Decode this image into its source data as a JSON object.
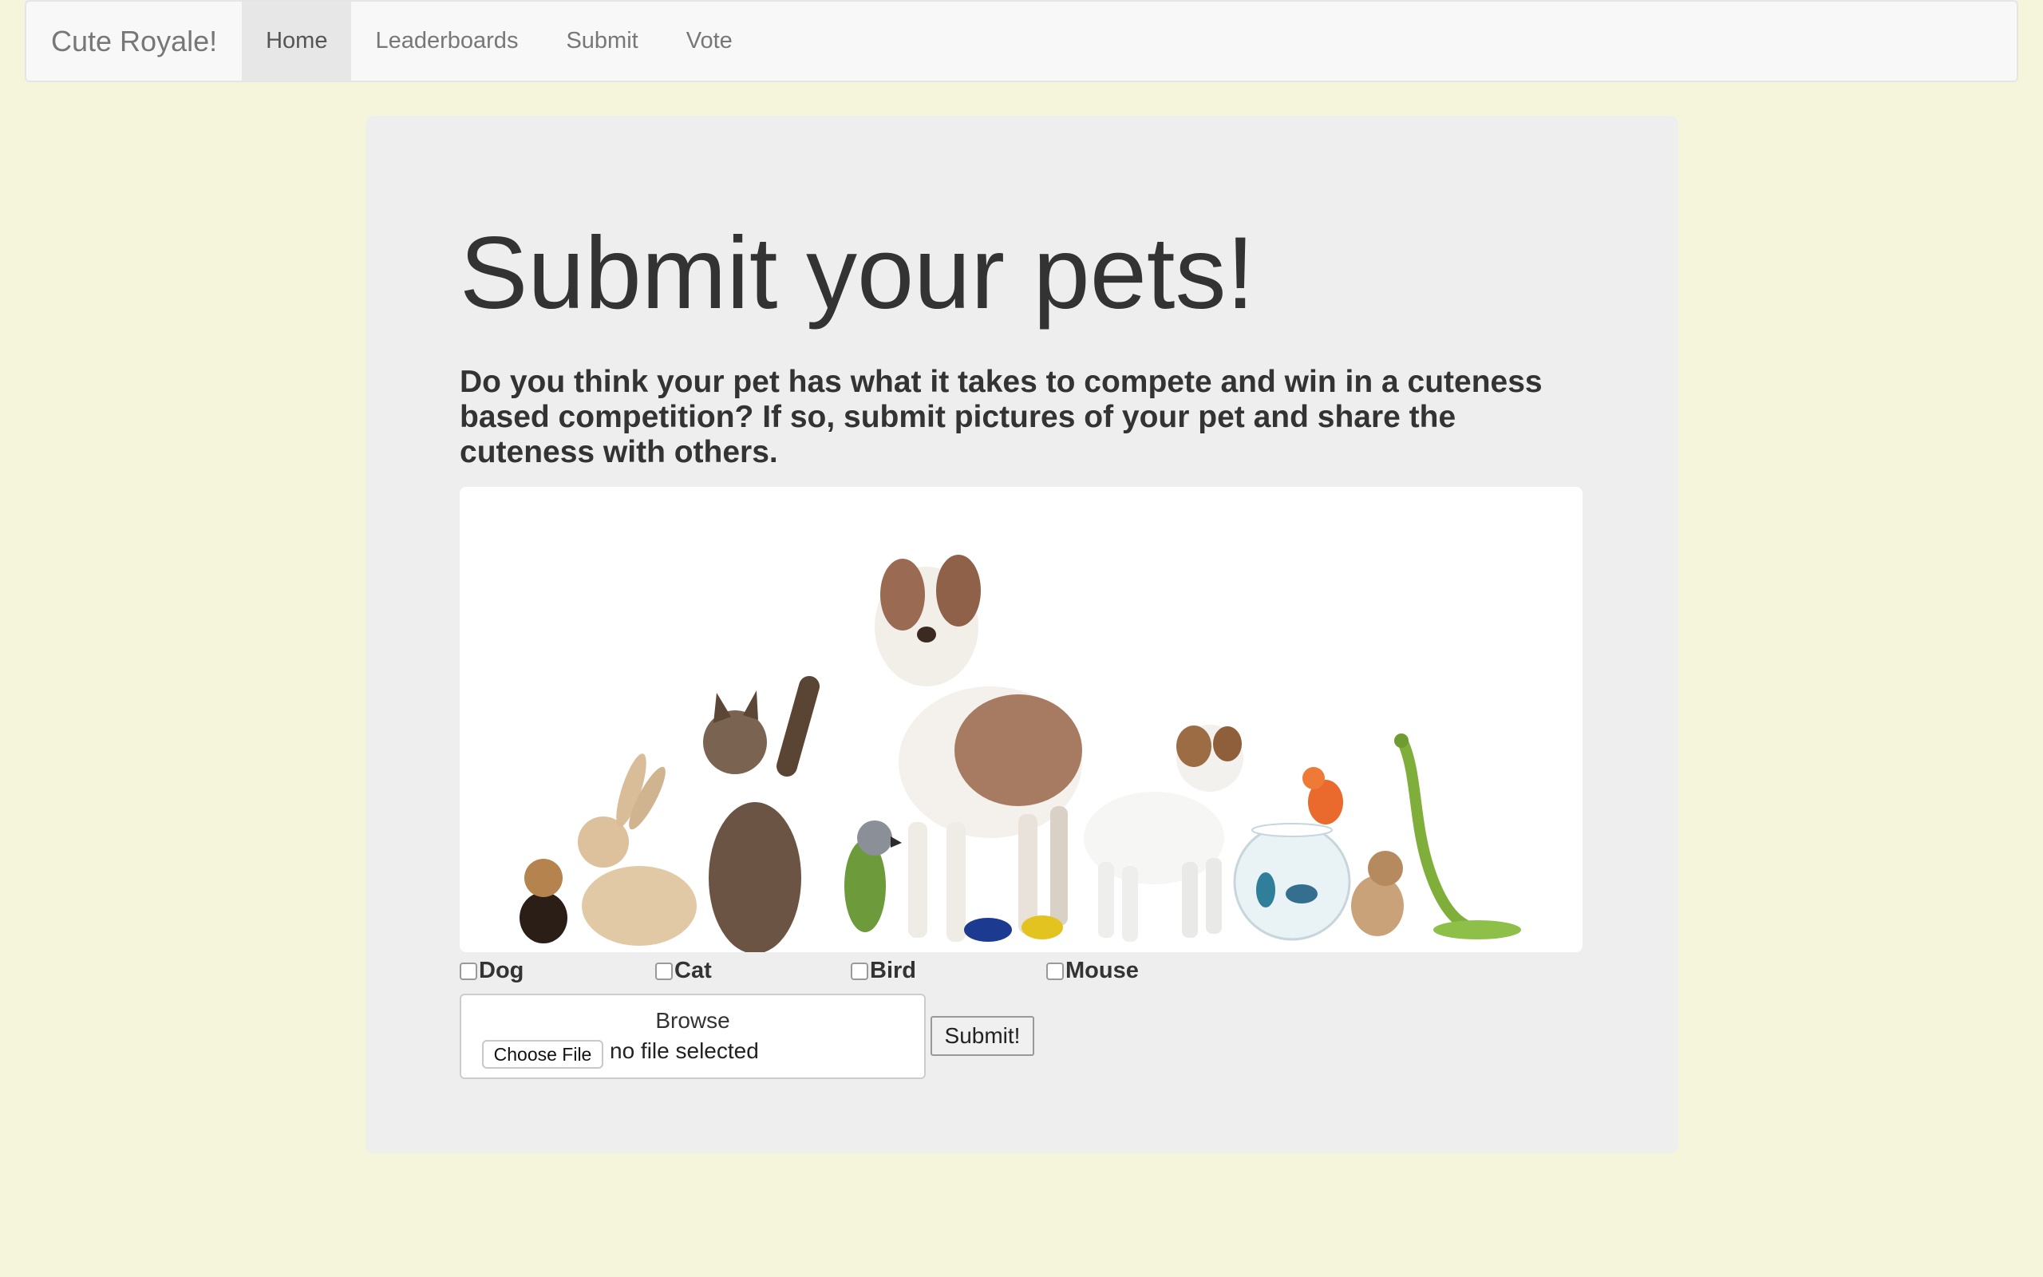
{
  "navbar": {
    "brand": "Cute Royale!",
    "items": [
      {
        "label": "Home",
        "active": true
      },
      {
        "label": "Leaderboards",
        "active": false
      },
      {
        "label": "Submit",
        "active": false
      },
      {
        "label": "Vote",
        "active": false
      }
    ]
  },
  "main": {
    "title": "Submit your pets!",
    "lead": "Do you think your pet has what it takes to compete and win in a cuteness based competition? If so, submit pictures of your pet and share the cuteness with others."
  },
  "form": {
    "checkboxes": [
      {
        "label": "Dog",
        "checked": false
      },
      {
        "label": "Cat",
        "checked": false
      },
      {
        "label": "Bird",
        "checked": false
      },
      {
        "label": "Mouse",
        "checked": false
      }
    ],
    "browse_label": "Browse",
    "choose_file_label": "Choose File",
    "file_status": "no file selected",
    "submit_label": "Submit!"
  },
  "colors": {
    "page_background": "#f5f5dc",
    "jumbotron_background": "#eeeeee",
    "navbar_background": "#f8f8f8"
  }
}
